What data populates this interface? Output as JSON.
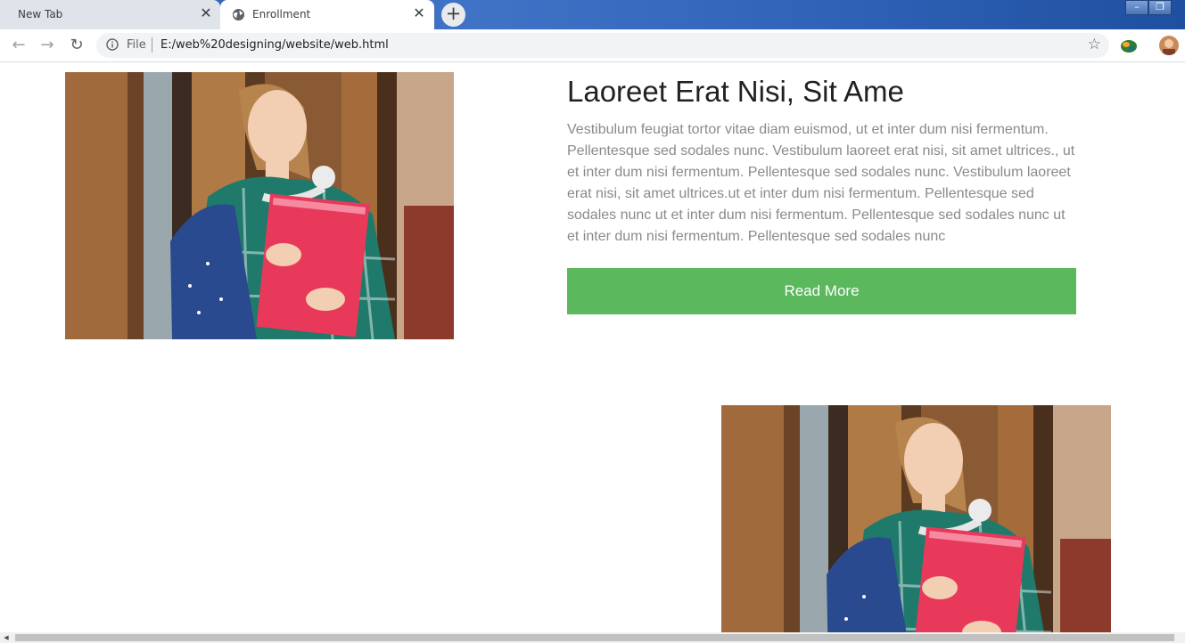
{
  "browser": {
    "tabs": [
      {
        "title": "New Tab",
        "active": false
      },
      {
        "title": "Enrollment",
        "active": true
      }
    ],
    "new_tab_symbol": "+",
    "close_symbol": "✕",
    "address_bar": {
      "scheme_label": "File",
      "url": "E:/web%20designing/website/web.html"
    },
    "icons": [
      "back-icon",
      "forward-icon",
      "reload-icon",
      "info-icon",
      "star-icon",
      "extension-icon",
      "profile-avatar",
      "globe-icon",
      "minimize-icon",
      "restore-icon"
    ]
  },
  "page": {
    "heading": "Laoreet Erat Nisi, Sit Ame",
    "paragraph": "Vestibulum feugiat tortor vitae diam euismod, ut et inter dum nisi fermentum. Pellentesque sed sodales nunc. Vestibulum laoreet erat nisi, sit amet ultrices., ut et inter dum nisi fermentum. Pellentesque sed sodales nunc. Vestibulum laoreet erat nisi, sit amet ultrices.ut et inter dum nisi fermentum. Pellentesque sed sodales nunc ut et inter dum nisi fermentum. Pellentesque sed sodales nunc ut et inter dum nisi fermentum. Pellentesque sed sodales nunc",
    "button_label": "Read More",
    "colors": {
      "button": "#5cb85c",
      "heading": "#212121",
      "paragraph": "#8a8a8a"
    }
  }
}
